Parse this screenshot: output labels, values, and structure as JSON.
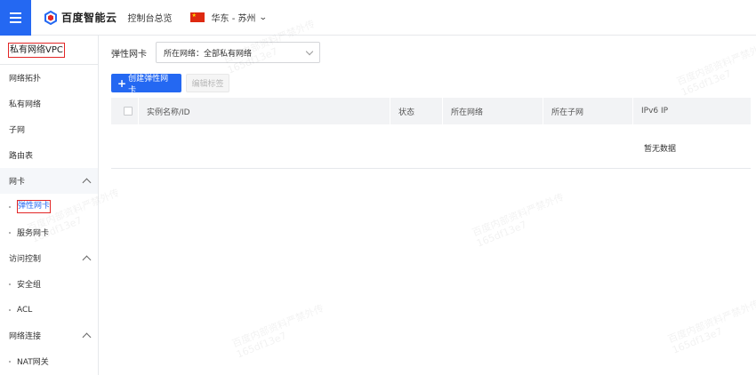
{
  "topbar": {
    "brand_name": "百度智能云",
    "console_link": "控制台总览",
    "region": "华东 - 苏州",
    "brand_color": "#2468f2"
  },
  "sidebar": {
    "title": "私有网络VPC",
    "items": [
      {
        "label": "网络拓扑"
      },
      {
        "label": "私有网络"
      },
      {
        "label": "子网"
      },
      {
        "label": "路由表"
      }
    ],
    "groups": [
      {
        "label": "网卡",
        "children": [
          "弹性网卡",
          "服务网卡"
        ]
      },
      {
        "label": "访问控制",
        "children": [
          "安全组",
          "ACL"
        ]
      },
      {
        "label": "网络连接",
        "children": [
          "NAT网关"
        ]
      }
    ]
  },
  "main": {
    "filter_label": "弹性网卡",
    "filter_select": "所在网络：全部私有网络",
    "create_button": "创建弹性网卡",
    "edit_tags_button": "编辑标签",
    "table": {
      "columns": [
        "实例名称/ID",
        "状态",
        "所在网络",
        "所在子网",
        "IPv6 IP"
      ],
      "empty_text": "暂无数据"
    }
  }
}
